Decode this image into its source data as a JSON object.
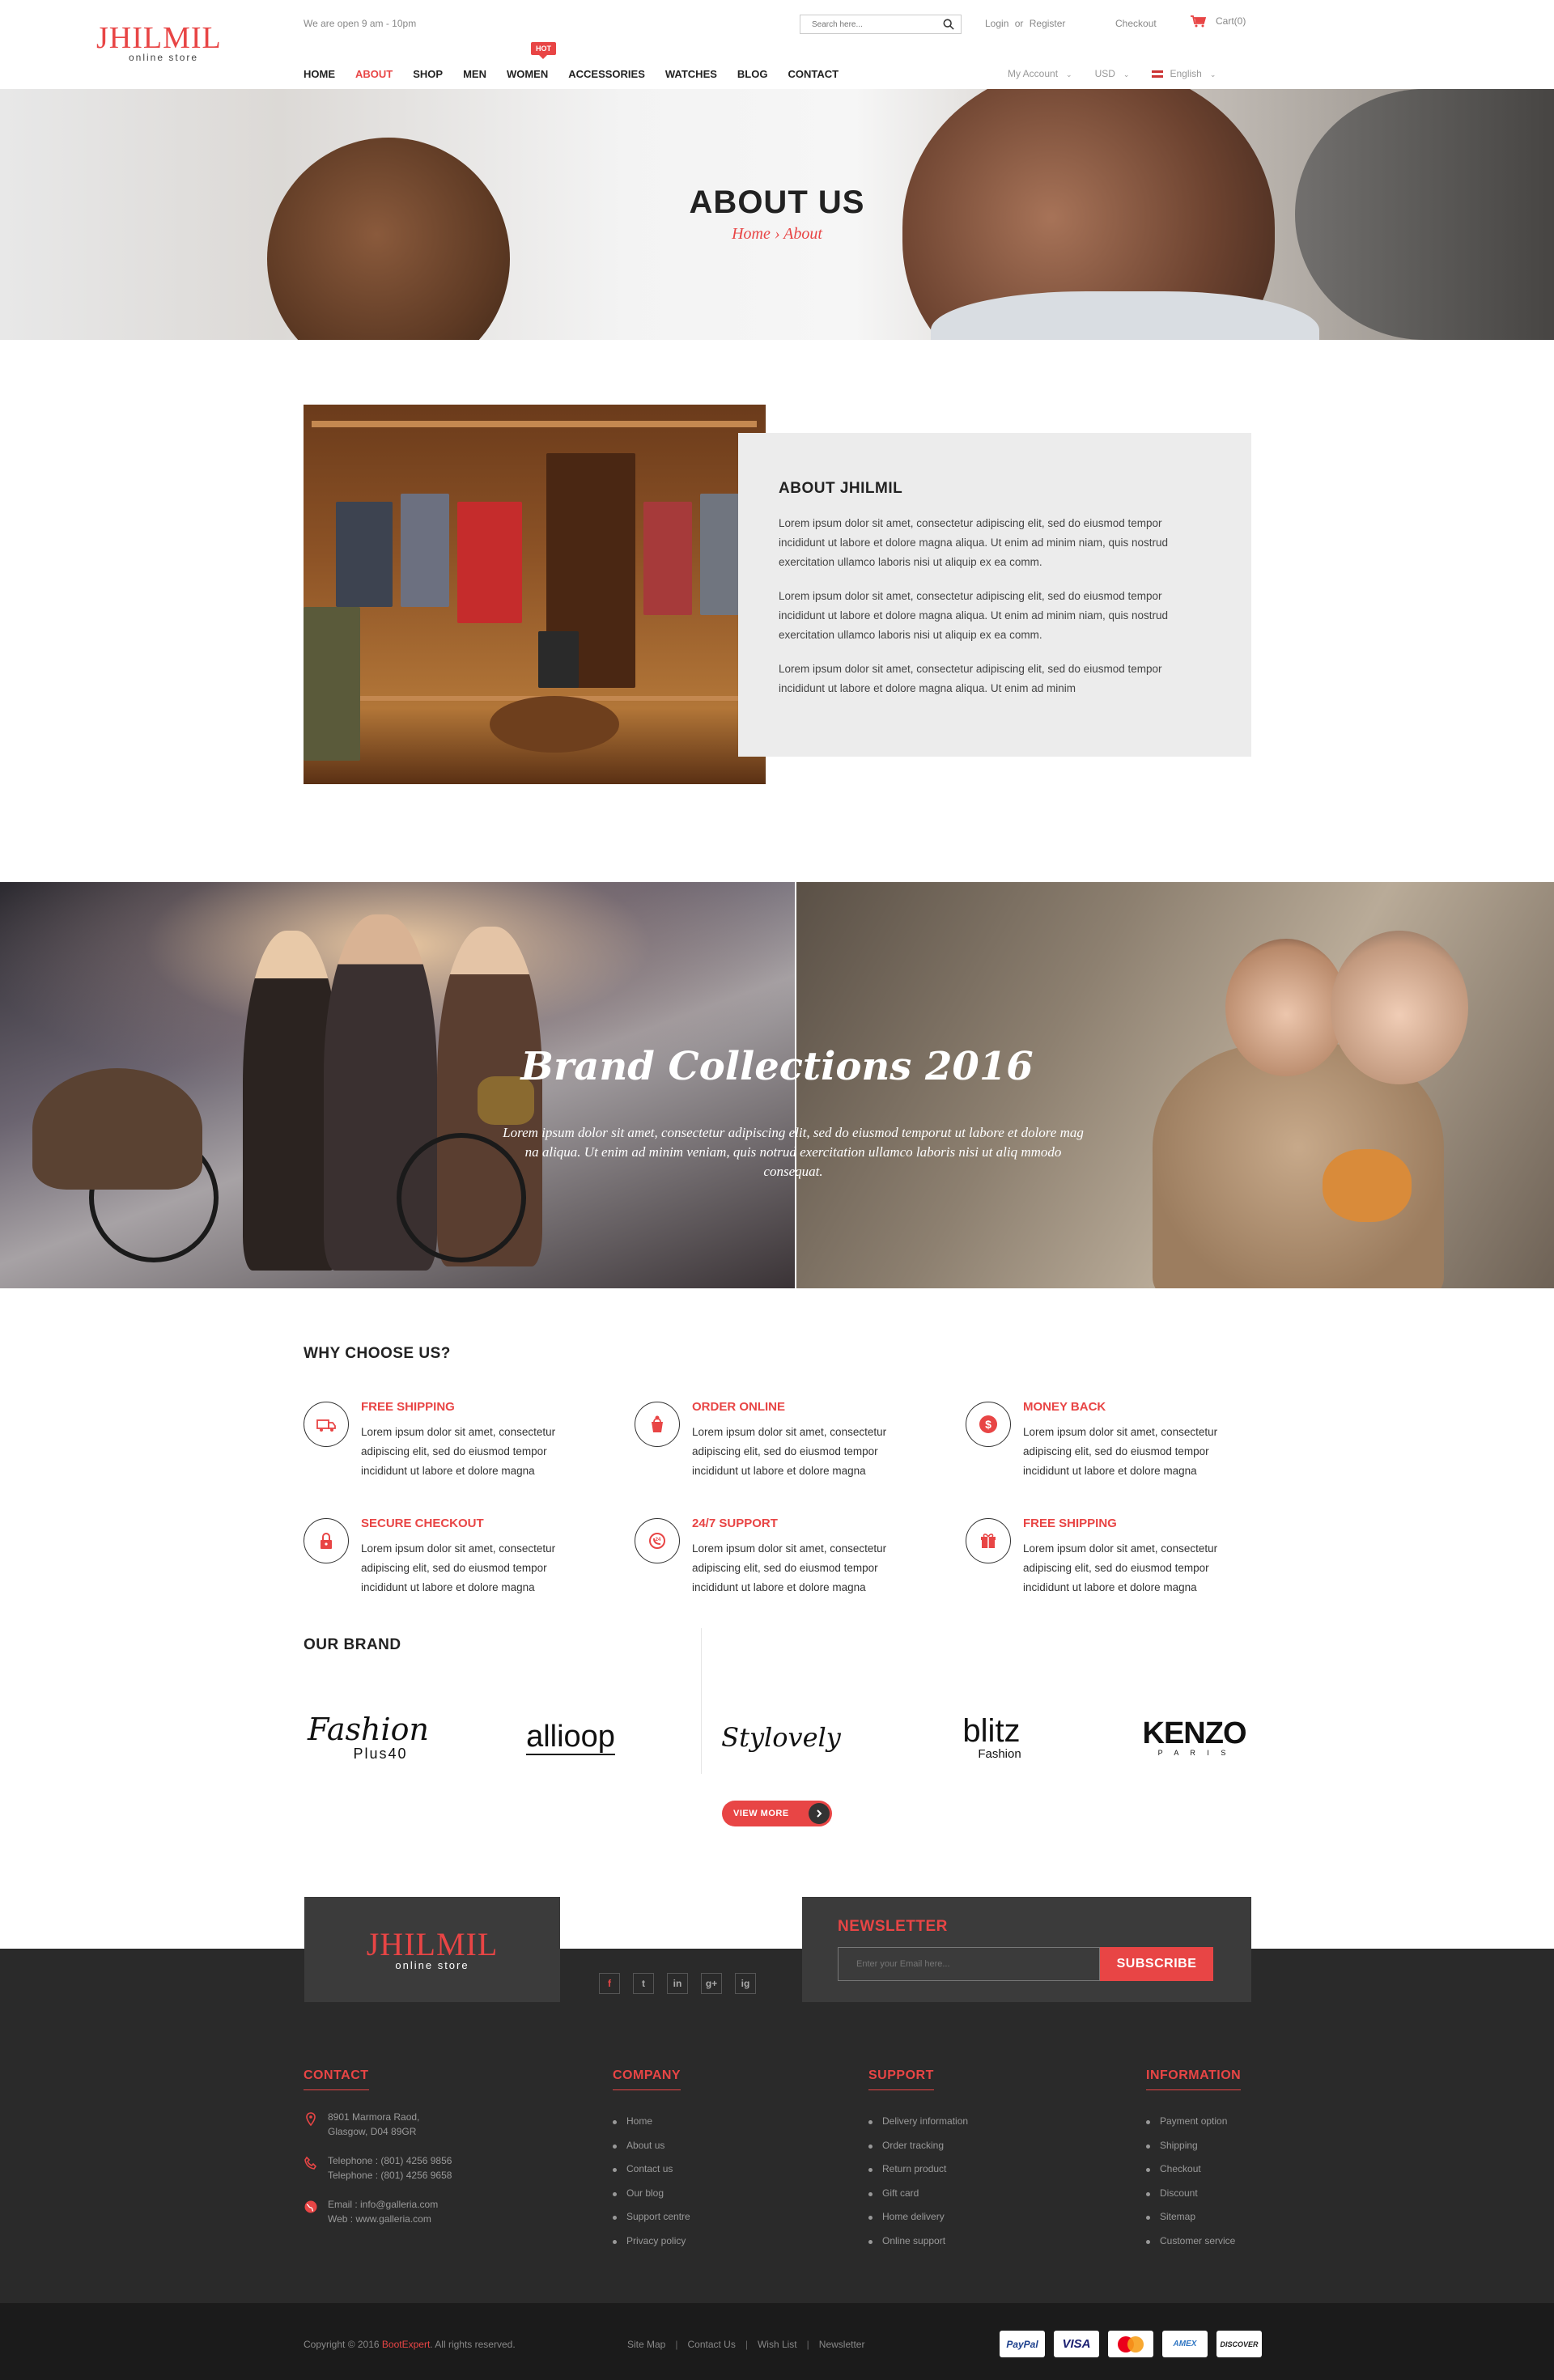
{
  "header": {
    "logo_main": "JHILMIL",
    "logo_sub": "online store",
    "open_hours": "We are open 9 am - 10pm",
    "search_placeholder": "Search here...",
    "login": "Login",
    "or": "or",
    "register": "Register",
    "checkout": "Checkout",
    "cart": "Cart(0)",
    "nav": [
      "HOME",
      "ABOUT",
      "SHOP",
      "MEN",
      "WOMEN",
      "ACCESSORIES",
      "WATCHES",
      "BLOG",
      "CONTACT"
    ],
    "active_nav": "ABOUT",
    "hot_badge": "HOT",
    "my_account": "My Account",
    "currency": "USD",
    "language": "English"
  },
  "hero": {
    "title": "ABOUT US",
    "breadcrumb": "Home › About"
  },
  "about": {
    "heading": "ABOUT JHILMIL",
    "paragraphs": [
      "Lorem ipsum dolor sit amet, consectetur adipiscing elit, sed do eiusmod tempor incididunt ut labore et dolore magna aliqua. Ut enim ad minim niam, quis nostrud exercitation ullamco laboris nisi ut aliquip ex ea comm.",
      "Lorem ipsum dolor sit amet, consectetur adipiscing elit, sed do eiusmod tempor incididunt ut labore et dolore magna aliqua. Ut enim ad minim niam, quis nostrud exercitation ullamco laboris nisi ut aliquip ex ea comm.",
      "Lorem ipsum dolor sit amet, consectetur adipiscing elit, sed do eiusmod tempor incididunt ut labore et dolore magna aliqua. Ut enim ad minim"
    ]
  },
  "collections": {
    "title": "Brand Collections 2016",
    "text": "Lorem ipsum dolor sit amet, consectetur adipiscing elit, sed do eiusmod temporut ut labore et dolore mag na aliqua. Ut enim ad minim veniam, quis notrud exercitation ullamco laboris nisi ut aliq mmodo consequat."
  },
  "why": {
    "title": "WHY CHOOSE US?",
    "features": [
      {
        "title": "FREE SHIPPING",
        "text": "Lorem ipsum dolor sit amet, consectetur adipiscing elit, sed do eiusmod tempor incididunt ut labore et dolore magna",
        "icon": "truck-icon"
      },
      {
        "title": "ORDER ONLINE",
        "text": "Lorem ipsum dolor sit amet, consectetur adipiscing elit, sed do eiusmod tempor incididunt ut labore et dolore magna",
        "icon": "bag-icon"
      },
      {
        "title": "MONEY BACK",
        "text": "Lorem ipsum dolor sit amet, consectetur adipiscing elit, sed do eiusmod tempor incididunt ut labore et dolore magna",
        "icon": "dollar-icon"
      },
      {
        "title": "SECURE CHECKOUT",
        "text": "Lorem ipsum dolor sit amet, consectetur adipiscing elit, sed do eiusmod tempor incididunt ut labore et dolore magna",
        "icon": "lock-icon"
      },
      {
        "title": "24/7 SUPPORT",
        "text": "Lorem ipsum dolor sit amet, consectetur adipiscing elit, sed do eiusmod tempor incididunt ut labore et dolore magna",
        "icon": "support-icon"
      },
      {
        "title": "FREE SHIPPING",
        "text": "Lorem ipsum dolor sit amet, consectetur adipiscing elit, sed do eiusmod tempor incididunt ut labore et dolore magna",
        "icon": "gift-icon"
      }
    ]
  },
  "brands": {
    "title": "OUR BRAND",
    "logos": [
      "Fashion Plus40",
      "allioop",
      "Stylovely",
      "blitz Fashion",
      "KENZO PARIS"
    ],
    "fashion_main": "Fashion",
    "fashion_sub": "Plus40",
    "allioop": "allioop",
    "stylovely": "Stylovely",
    "blitz_main": "blitz",
    "blitz_sub": "Fashion",
    "kenzo_main": "KENZO",
    "kenzo_sub": "P A R I S",
    "view_more": "VIEW MORE"
  },
  "footer": {
    "logo_main": "JHILMIL",
    "logo_sub": "online store",
    "socials": [
      "f",
      "t",
      "in",
      "g+",
      "ig"
    ],
    "newsletter_title": "NEWSLETTER",
    "newsletter_placeholder": "Enter your Email here...",
    "subscribe": "SUBSCRIBE",
    "contact_title": "CONTACT",
    "address_1": "8901 Marmora Raod,",
    "address_2": "Glasgow, D04  89GR",
    "phone_1": "Telephone : (801) 4256  9856",
    "phone_2": "Telephone : (801) 4256  9658",
    "email": "Email : info@galleria.com",
    "web": "Web : www.galleria.com",
    "company_title": "COMPANY",
    "company": [
      "Home",
      "About us",
      "Contact us",
      "Our blog",
      "Support centre",
      "Privacy policy"
    ],
    "support_title": "SUPPORT",
    "support": [
      "Delivery information",
      "Order tracking",
      "Return product",
      "Gift card",
      "Home delivery",
      "Online support"
    ],
    "information_title": "INFORMATION",
    "information": [
      "Payment option",
      "Shipping",
      "Checkout",
      "Discount",
      "Sitemap",
      "Customer service"
    ],
    "copyright_pre": "Copyright © 2016",
    "copyright_brand": "BootExpert",
    "copyright_post": ". All rights reserved.",
    "bottom_links": [
      "Site Map",
      "Contact Us",
      "Wish List",
      "Newsletter"
    ],
    "payments": [
      "PayPal",
      "VISA",
      "MasterCard",
      "AMEX",
      "DISCOVER"
    ]
  },
  "colors": {
    "accent": "#e84545",
    "footer_bg": "#2a2a2a",
    "footer_bottom": "#1b1b1b"
  }
}
